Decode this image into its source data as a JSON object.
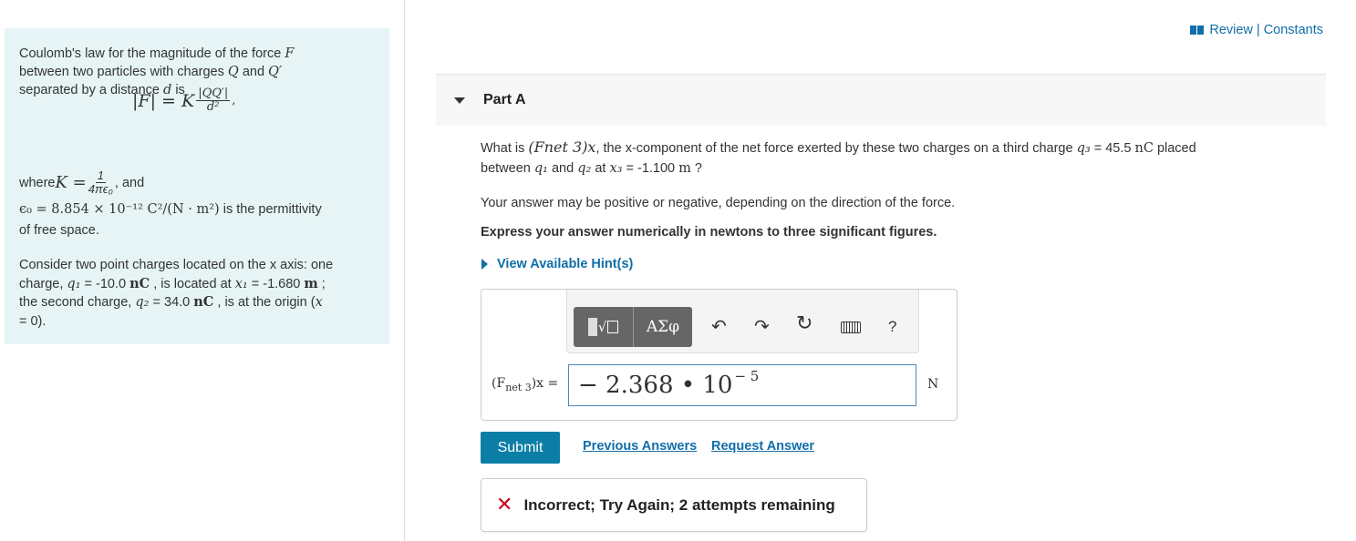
{
  "intro": {
    "line1_pre": "Coulomb's law for the magnitude of the force ",
    "var_F": "F",
    "line2_pre": "between two particles with charges ",
    "var_Q": "Q",
    "and": " and ",
    "var_Qp": "Q′",
    "line3_pre": "separated by a distance ",
    "var_d": "d",
    "line3_post": " is",
    "formula_lhs": "|F| = K",
    "formula_num": "|QQ′|",
    "formula_den": "d²",
    "formula_comma": ",",
    "where": "where ",
    "K_eq": "K = ",
    "k_num": "1",
    "k_den": "4πϵ₀",
    "comma_and": ", and",
    "eps_line": "ϵ₀ = 8.854 × 10⁻¹² C²/(N · m²)",
    "eps_post": " is the permittivity",
    "free_space": "of free space.",
    "consider_1": "Consider two point charges located on the x axis: one",
    "consider_2_pre": "charge, ",
    "q1": "q₁",
    "consider_2_mid": " = -10.0 ",
    "nC": "nC",
    "consider_2_mid2": " , is located at ",
    "x1": "x₁",
    "consider_2_post": " = -1.680 ",
    "m": "m",
    "semicolon": " ;",
    "consider_3_pre": "the second charge, ",
    "q2": "q₂",
    "consider_3_mid": " = 34.0 ",
    "consider_3_post": " , is at the origin (",
    "x": "x",
    "consider_4": "= 0)."
  },
  "review": {
    "label": "Review | Constants"
  },
  "part": {
    "title": "Part A"
  },
  "question": {
    "what_is": "What is ",
    "fnet": "(Fnet 3)x",
    "line1_post": ", the x-component of the net force exerted by these two charges on a third charge ",
    "q3": "q₃",
    "q3_val": " = 45.5 ",
    "nC": "nC",
    "placed": " placed",
    "line2_pre": "between ",
    "q1": "q₁",
    "and": " and ",
    "q2": "q₂",
    "at": " at ",
    "x3": "x₃",
    "x3_val": " = -1.100 ",
    "m": "m",
    "qmark": " ?",
    "sign_note": "Your answer may be positive or negative, depending on the direction of the force.",
    "express": "Express your answer numerically in newtons to three significant figures."
  },
  "hint": {
    "label": "View Available Hint(s)"
  },
  "toolbar": {
    "greek": "ΑΣφ",
    "undo_icon": "↶",
    "redo_icon": "↷",
    "reset_icon": "↻",
    "help": "?"
  },
  "answer": {
    "label_pre": "(F",
    "label_sub": "net 3",
    "label_post": ")x =",
    "value": "− 2.368 • 10",
    "exponent": "− 5",
    "unit": "N"
  },
  "actions": {
    "submit": "Submit",
    "previous": "Previous Answers",
    "request": "Request Answer"
  },
  "feedback": {
    "icon": "✕",
    "message": "Incorrect; Try Again; 2 attempts remaining"
  },
  "colors": {
    "accent": "#116ea9",
    "submit_bg": "#0b7ea6",
    "error": "#d0021b",
    "panel_bg": "#e6f4f5"
  }
}
